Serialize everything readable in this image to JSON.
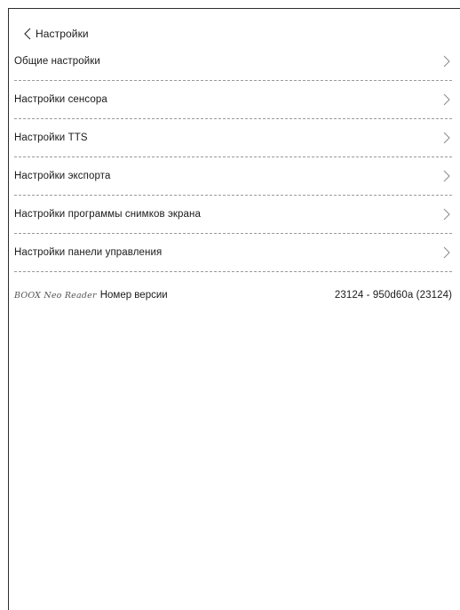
{
  "header": {
    "back_icon": "chevron-left-icon",
    "title": "Настройки"
  },
  "menu": {
    "items": [
      {
        "label": "Общие настройки",
        "icon": "chevron-right-icon"
      },
      {
        "label": "Настройки сенсора",
        "icon": "chevron-right-icon"
      },
      {
        "label": "Настройки TTS",
        "icon": "chevron-right-icon"
      },
      {
        "label": "Настройки экспорта",
        "icon": "chevron-right-icon"
      },
      {
        "label": "Настройки программы снимков экрана",
        "icon": "chevron-right-icon"
      },
      {
        "label": "Настройки панели управления",
        "icon": "chevron-right-icon"
      }
    ]
  },
  "version": {
    "brand": "BOOX Neo Reader",
    "label": "Номер версии",
    "value": "23124 - 950d60a (23124)"
  },
  "colors": {
    "background": "#ffffff",
    "text": "#1a1a1a",
    "divider": "#9a9a9a",
    "chevron": "#8a8a8a"
  }
}
